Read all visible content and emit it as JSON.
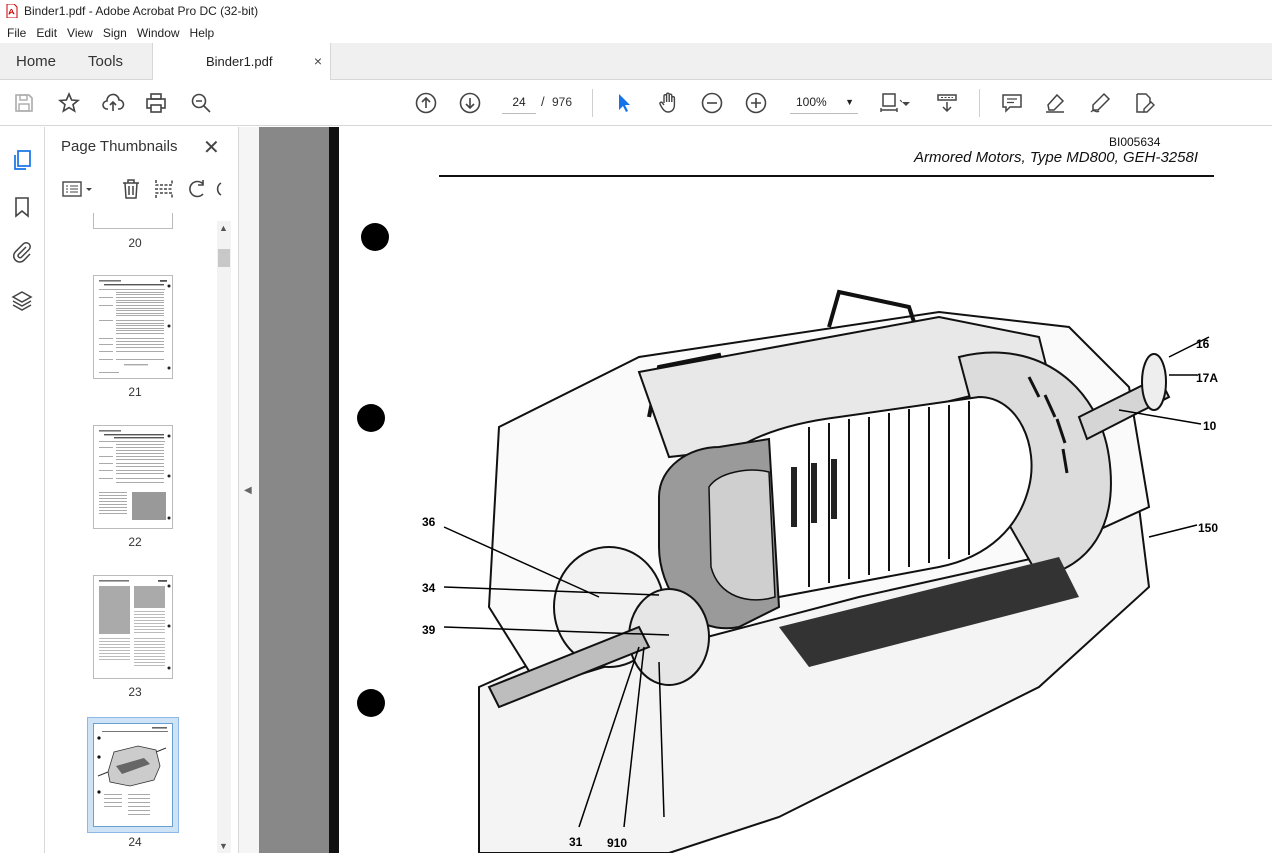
{
  "window": {
    "title": "Binder1.pdf - Adobe Acrobat Pro DC (32-bit)"
  },
  "menu": {
    "items": [
      "File",
      "Edit",
      "View",
      "Sign",
      "Window",
      "Help"
    ]
  },
  "tabs": {
    "home": "Home",
    "tools": "Tools",
    "document": "Binder1.pdf",
    "close_symbol": "×"
  },
  "toolbar": {
    "current_page": "24",
    "page_separator": "/",
    "total_pages": "976",
    "zoom": "100%",
    "zoom_caret": "▼"
  },
  "thumbnails_panel": {
    "title": "Page Thumbnails",
    "close_symbol": "✕",
    "thumbnails": [
      {
        "label": "20"
      },
      {
        "label": "21"
      },
      {
        "label": "22"
      },
      {
        "label": "23"
      },
      {
        "label": "24",
        "selected": true
      }
    ]
  },
  "document": {
    "doc_id": "BI005634",
    "header": "Armored Motors, Type MD800, GEH-3258I",
    "callouts": [
      "16",
      "17A",
      "10",
      "150",
      "36",
      "34",
      "39",
      "31",
      "910"
    ]
  },
  "colors": {
    "accent": "#1473e6",
    "viewport_bg": "#888888",
    "selected_thumb": "#cfe3f6"
  }
}
